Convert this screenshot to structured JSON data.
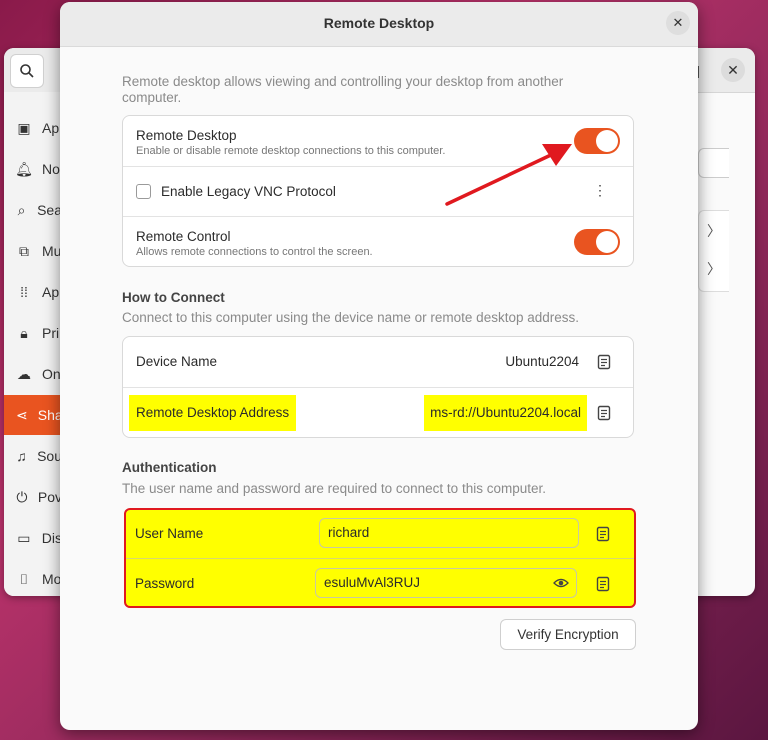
{
  "background_window": {
    "sidebar_items": [
      {
        "icon": "apps-icon",
        "label": "Ap"
      },
      {
        "icon": "bell-icon",
        "label": "No"
      },
      {
        "icon": "search-icon",
        "label": "Sea"
      },
      {
        "icon": "multitasking-icon",
        "label": "Mu"
      },
      {
        "icon": "grid-icon",
        "label": "Ap"
      },
      {
        "icon": "lock-icon",
        "label": "Pri"
      },
      {
        "icon": "cloud-icon",
        "label": "On"
      },
      {
        "icon": "share-icon",
        "label": "Sha"
      },
      {
        "icon": "music-note-icon",
        "label": "Sou"
      },
      {
        "icon": "power-icon",
        "label": "Pov"
      },
      {
        "icon": "display-icon",
        "label": "Dis"
      },
      {
        "icon": "mouse-icon",
        "label": "Mo"
      }
    ]
  },
  "dialog": {
    "title": "Remote Desktop",
    "description": "Remote desktop allows viewing and controlling your desktop from another computer.",
    "toggles": {
      "remote_desktop": {
        "title": "Remote Desktop",
        "subtitle": "Enable or disable remote desktop connections to this computer.",
        "on": true
      },
      "legacy_vnc": {
        "title": "Enable Legacy VNC Protocol",
        "checked": false
      },
      "remote_control": {
        "title": "Remote Control",
        "subtitle": "Allows remote connections to control the screen.",
        "on": true
      }
    },
    "how_to_connect": {
      "heading": "How to Connect",
      "description": "Connect to this computer using the device name or remote desktop address.",
      "device_name_label": "Device Name",
      "device_name_value": "Ubuntu2204",
      "address_label": "Remote Desktop Address",
      "address_value": "ms-rd://Ubuntu2204.local"
    },
    "authentication": {
      "heading": "Authentication",
      "description": "The user name and password are required to connect to this computer.",
      "username_label": "User Name",
      "username_value": "richard",
      "password_label": "Password",
      "password_value": "esuluMvAl3RUJ"
    },
    "verify_button": "Verify Encryption"
  },
  "colors": {
    "accent": "#e95420",
    "highlight": "#ffff00",
    "annotation_red": "#e0191f"
  }
}
